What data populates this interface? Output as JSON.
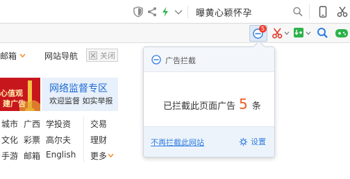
{
  "address_bar": {
    "search_text": "曝黄心颖怀孕",
    "icons": [
      "shield-icon",
      "share-icon",
      "lightning-icon",
      "chevron-down-icon",
      "search-icon",
      "phone-icon",
      "scissors-icon"
    ]
  },
  "toolbar": {
    "adblock_badge": "5",
    "icons": [
      "adblock-icon",
      "scissors-icon",
      "download-icon",
      "magnifier-icon",
      "game-icon"
    ]
  },
  "page": {
    "nav": {
      "mail_label": "邮箱",
      "site_nav_label": "网站导航",
      "close_label": "关闭"
    },
    "banner_left": {
      "line1": "心值观",
      "line2": "建广告"
    },
    "banner_right": {
      "title": "网络监督专区",
      "subtitle": "欢迎监督 如实举报"
    },
    "grid": [
      [
        "城市",
        "广西",
        "学投资",
        "交易"
      ],
      [
        "文化",
        "彩票",
        "高尔夫",
        "理财"
      ],
      [
        "手游",
        "邮箱",
        "English",
        "更多"
      ]
    ]
  },
  "popup": {
    "title": "广告拦截",
    "message_prefix": "已拦截此页面广告",
    "count": "5",
    "message_suffix": "条",
    "disable_link": "不再拦截此网站",
    "settings_label": "设置"
  },
  "colors": {
    "accent_blue": "#2f7de1",
    "count_orange": "#f05a23",
    "banner_red": "#c8161d",
    "banner_blue_text": "#1f6ad4",
    "green": "#2cb34a"
  }
}
